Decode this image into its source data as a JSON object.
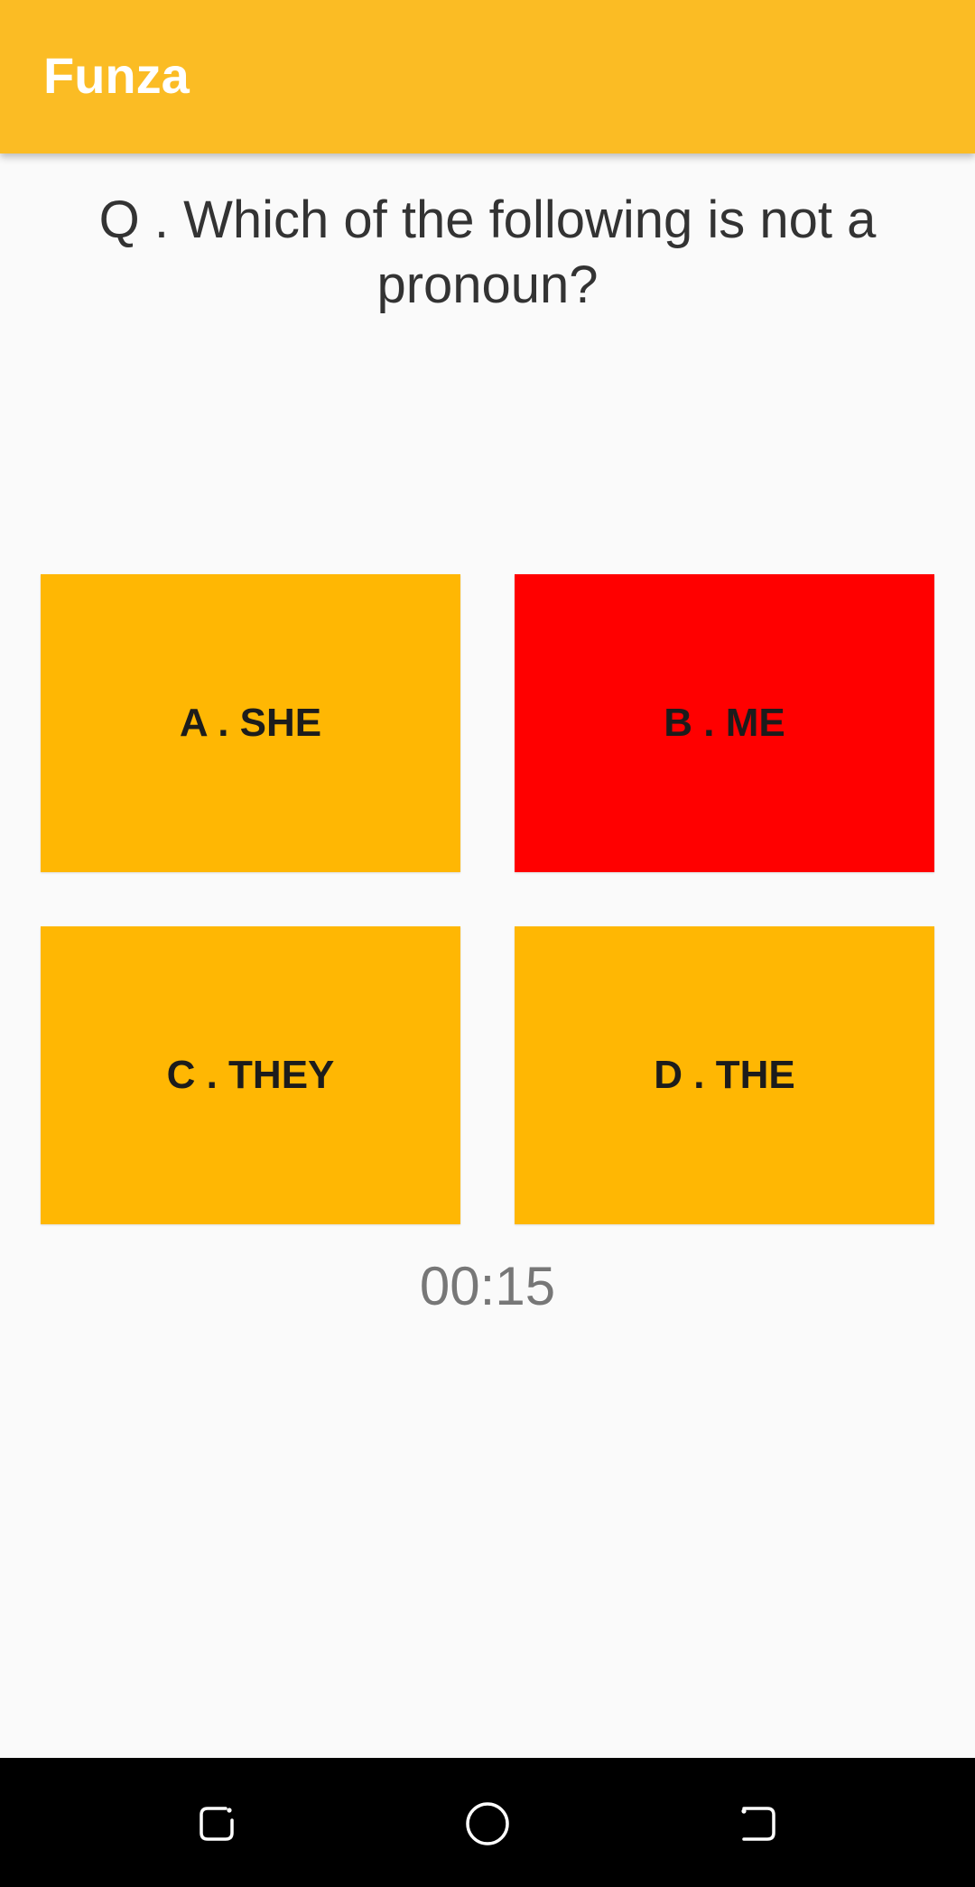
{
  "app": {
    "title": "Funza",
    "accent_color": "#fbbc24"
  },
  "question": {
    "text": "Q .  Which of the following is not a pronoun?"
  },
  "options": [
    {
      "label": "A . SHE",
      "color": "#ffb703",
      "state": "default"
    },
    {
      "label": "B . ME",
      "color": "#ff0000",
      "state": "wrong"
    },
    {
      "label": "C . THEY",
      "color": "#ffb703",
      "state": "default"
    },
    {
      "label": "D . THE",
      "color": "#ffb703",
      "state": "default"
    }
  ],
  "timer": {
    "value": "00:15"
  },
  "navbar": {
    "buttons": [
      {
        "icon": "recent-apps-icon"
      },
      {
        "icon": "home-icon"
      },
      {
        "icon": "back-icon"
      }
    ]
  }
}
